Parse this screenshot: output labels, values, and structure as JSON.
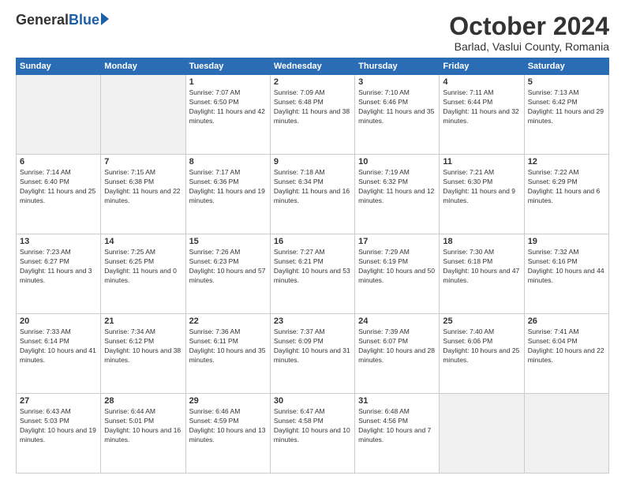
{
  "logo": {
    "general": "General",
    "blue": "Blue"
  },
  "title": "October 2024",
  "subtitle": "Barlad, Vaslui County, Romania",
  "days_of_week": [
    "Sunday",
    "Monday",
    "Tuesday",
    "Wednesday",
    "Thursday",
    "Friday",
    "Saturday"
  ],
  "weeks": [
    [
      {
        "day": "",
        "info": ""
      },
      {
        "day": "",
        "info": ""
      },
      {
        "day": "1",
        "info": "Sunrise: 7:07 AM\nSunset: 6:50 PM\nDaylight: 11 hours and 42 minutes."
      },
      {
        "day": "2",
        "info": "Sunrise: 7:09 AM\nSunset: 6:48 PM\nDaylight: 11 hours and 38 minutes."
      },
      {
        "day": "3",
        "info": "Sunrise: 7:10 AM\nSunset: 6:46 PM\nDaylight: 11 hours and 35 minutes."
      },
      {
        "day": "4",
        "info": "Sunrise: 7:11 AM\nSunset: 6:44 PM\nDaylight: 11 hours and 32 minutes."
      },
      {
        "day": "5",
        "info": "Sunrise: 7:13 AM\nSunset: 6:42 PM\nDaylight: 11 hours and 29 minutes."
      }
    ],
    [
      {
        "day": "6",
        "info": "Sunrise: 7:14 AM\nSunset: 6:40 PM\nDaylight: 11 hours and 25 minutes."
      },
      {
        "day": "7",
        "info": "Sunrise: 7:15 AM\nSunset: 6:38 PM\nDaylight: 11 hours and 22 minutes."
      },
      {
        "day": "8",
        "info": "Sunrise: 7:17 AM\nSunset: 6:36 PM\nDaylight: 11 hours and 19 minutes."
      },
      {
        "day": "9",
        "info": "Sunrise: 7:18 AM\nSunset: 6:34 PM\nDaylight: 11 hours and 16 minutes."
      },
      {
        "day": "10",
        "info": "Sunrise: 7:19 AM\nSunset: 6:32 PM\nDaylight: 11 hours and 12 minutes."
      },
      {
        "day": "11",
        "info": "Sunrise: 7:21 AM\nSunset: 6:30 PM\nDaylight: 11 hours and 9 minutes."
      },
      {
        "day": "12",
        "info": "Sunrise: 7:22 AM\nSunset: 6:29 PM\nDaylight: 11 hours and 6 minutes."
      }
    ],
    [
      {
        "day": "13",
        "info": "Sunrise: 7:23 AM\nSunset: 6:27 PM\nDaylight: 11 hours and 3 minutes."
      },
      {
        "day": "14",
        "info": "Sunrise: 7:25 AM\nSunset: 6:25 PM\nDaylight: 11 hours and 0 minutes."
      },
      {
        "day": "15",
        "info": "Sunrise: 7:26 AM\nSunset: 6:23 PM\nDaylight: 10 hours and 57 minutes."
      },
      {
        "day": "16",
        "info": "Sunrise: 7:27 AM\nSunset: 6:21 PM\nDaylight: 10 hours and 53 minutes."
      },
      {
        "day": "17",
        "info": "Sunrise: 7:29 AM\nSunset: 6:19 PM\nDaylight: 10 hours and 50 minutes."
      },
      {
        "day": "18",
        "info": "Sunrise: 7:30 AM\nSunset: 6:18 PM\nDaylight: 10 hours and 47 minutes."
      },
      {
        "day": "19",
        "info": "Sunrise: 7:32 AM\nSunset: 6:16 PM\nDaylight: 10 hours and 44 minutes."
      }
    ],
    [
      {
        "day": "20",
        "info": "Sunrise: 7:33 AM\nSunset: 6:14 PM\nDaylight: 10 hours and 41 minutes."
      },
      {
        "day": "21",
        "info": "Sunrise: 7:34 AM\nSunset: 6:12 PM\nDaylight: 10 hours and 38 minutes."
      },
      {
        "day": "22",
        "info": "Sunrise: 7:36 AM\nSunset: 6:11 PM\nDaylight: 10 hours and 35 minutes."
      },
      {
        "day": "23",
        "info": "Sunrise: 7:37 AM\nSunset: 6:09 PM\nDaylight: 10 hours and 31 minutes."
      },
      {
        "day": "24",
        "info": "Sunrise: 7:39 AM\nSunset: 6:07 PM\nDaylight: 10 hours and 28 minutes."
      },
      {
        "day": "25",
        "info": "Sunrise: 7:40 AM\nSunset: 6:06 PM\nDaylight: 10 hours and 25 minutes."
      },
      {
        "day": "26",
        "info": "Sunrise: 7:41 AM\nSunset: 6:04 PM\nDaylight: 10 hours and 22 minutes."
      }
    ],
    [
      {
        "day": "27",
        "info": "Sunrise: 6:43 AM\nSunset: 5:03 PM\nDaylight: 10 hours and 19 minutes."
      },
      {
        "day": "28",
        "info": "Sunrise: 6:44 AM\nSunset: 5:01 PM\nDaylight: 10 hours and 16 minutes."
      },
      {
        "day": "29",
        "info": "Sunrise: 6:46 AM\nSunset: 4:59 PM\nDaylight: 10 hours and 13 minutes."
      },
      {
        "day": "30",
        "info": "Sunrise: 6:47 AM\nSunset: 4:58 PM\nDaylight: 10 hours and 10 minutes."
      },
      {
        "day": "31",
        "info": "Sunrise: 6:48 AM\nSunset: 4:56 PM\nDaylight: 10 hours and 7 minutes."
      },
      {
        "day": "",
        "info": ""
      },
      {
        "day": "",
        "info": ""
      }
    ]
  ]
}
